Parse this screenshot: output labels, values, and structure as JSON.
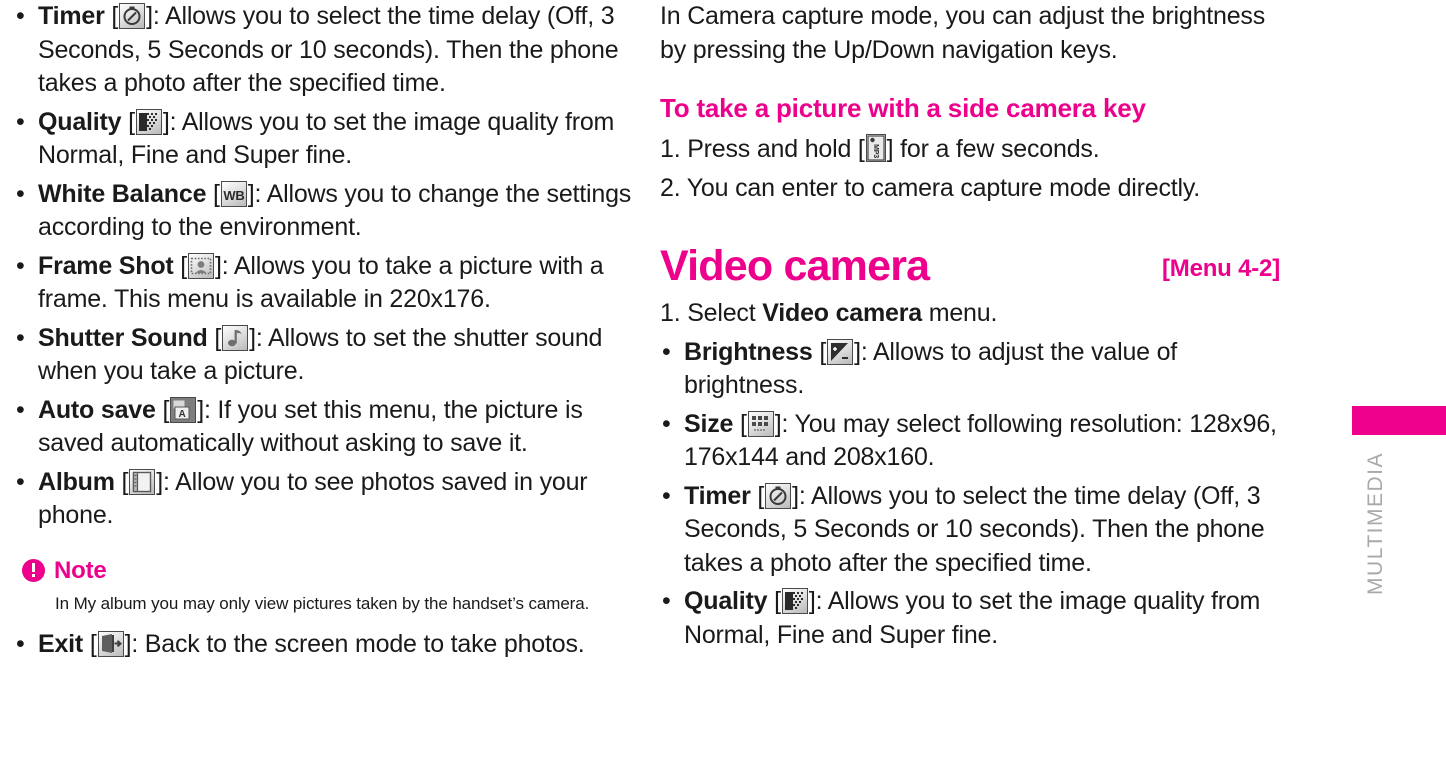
{
  "document": {
    "type": "mobile-phone-user-manual-page",
    "accent_color": "#ec008c",
    "text_color": "#1a1a1a",
    "sidebar_label_color": "#a7a9ac"
  },
  "sidebar": {
    "section_label": "MULTIMEDIA",
    "tab_color": "#ec008c"
  },
  "left_column": {
    "bullets": [
      {
        "term": "Timer",
        "icon": "timer-icon",
        "text": ": Allows you to select the time delay (Off, 3 Seconds, 5 Seconds or 10 seconds). Then the phone takes a photo after the specified time."
      },
      {
        "term": "Quality",
        "icon": "quality-dither-icon",
        "text": ": Allows you to set the image quality from Normal, Fine and Super fine."
      },
      {
        "term": "White Balance",
        "icon": "white-balance-icon",
        "text": ": Allows you to change the settings according to the environment."
      },
      {
        "term": "Frame Shot",
        "icon": "frame-shot-icon",
        "text": ": Allows you to take a picture with a frame. This menu is available in 220x176."
      },
      {
        "term": "Shutter Sound",
        "icon": "shutter-sound-icon",
        "text": ": Allows to set the shutter sound when you take a picture."
      },
      {
        "term": "Auto save",
        "icon": "auto-save-icon",
        "text": ": If you set this menu, the picture is saved automatically without asking to save it."
      },
      {
        "term": "Album",
        "icon": "album-icon",
        "text": ": Allow you to see photos saved in your phone."
      }
    ],
    "note": {
      "icon": "note-exclamation-icon",
      "title": "Note",
      "body": "In My album you may only view pictures taken by the handset’s camera."
    },
    "exit_bullet": {
      "term": "Exit",
      "icon": "exit-door-icon",
      "text": ": Back to the screen mode to take photos."
    }
  },
  "right_column": {
    "intro_paragraph": "In Camera capture mode, you can adjust the brightness by pressing the Up/Down navigation keys.",
    "subheading": "To take a picture with a side camera key",
    "steps": [
      {
        "number": "1.",
        "pre": " Press and hold [",
        "icon": "mp3-side-key-icon",
        "post": "] for a few seconds."
      },
      {
        "number": "2.",
        "pre": " You can enter to camera capture mode directly.",
        "icon": "",
        "post": ""
      }
    ],
    "section": {
      "title": "Video camera",
      "menu_tag": "[Menu 4-2]"
    },
    "first_step": {
      "prefix": "1. Select ",
      "bold": "Video camera",
      "suffix": " menu."
    },
    "bullets": [
      {
        "term": "Brightness",
        "icon": "brightness-icon",
        "text": ": Allows to adjust the value of brightness."
      },
      {
        "term": "Size",
        "icon": "size-grid-icon",
        "text": ": You may select following resolution: 128x96, 176x144 and 208x160."
      },
      {
        "term": "Timer",
        "icon": "timer-icon",
        "text": ": Allows you to select the time delay (Off, 3 Seconds, 5 Seconds or 10 seconds). Then the phone takes a photo after the specified time."
      },
      {
        "term": "Quality",
        "icon": "quality-dither-icon",
        "text": ": Allows you to set the image quality from Normal, Fine and Super fine."
      }
    ]
  }
}
